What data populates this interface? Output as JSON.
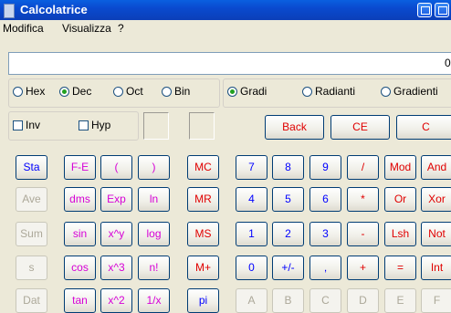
{
  "window": {
    "title": "Calcolatrice"
  },
  "menu": [
    "Modifica",
    "Visualizza",
    "?"
  ],
  "display": {
    "value": "0,"
  },
  "base_radios": [
    {
      "label": "Hex",
      "selected": false
    },
    {
      "label": "Dec",
      "selected": true
    },
    {
      "label": "Oct",
      "selected": false
    },
    {
      "label": "Bin",
      "selected": false
    }
  ],
  "angle_radios": [
    {
      "label": "Gradi",
      "selected": true
    },
    {
      "label": "Radianti",
      "selected": false
    },
    {
      "label": "Gradienti",
      "selected": false
    }
  ],
  "checkboxes": [
    {
      "label": "Inv",
      "checked": false
    },
    {
      "label": "Hyp",
      "checked": false
    }
  ],
  "edit_buttons": [
    "Back",
    "CE",
    "C"
  ],
  "sci_rows": [
    [
      "Sta",
      "F-E",
      "(",
      ")"
    ],
    [
      "Ave",
      "dms",
      "Exp",
      "ln"
    ],
    [
      "Sum",
      "sin",
      "x^y",
      "log"
    ],
    [
      "s",
      "cos",
      "x^3",
      "n!"
    ],
    [
      "Dat",
      "tan",
      "x^2",
      "1/x"
    ]
  ],
  "memory_buttons": [
    "MC",
    "MR",
    "MS",
    "M+",
    "pi"
  ],
  "num_rows": [
    [
      "7",
      "8",
      "9",
      "/",
      "Mod",
      "And"
    ],
    [
      "4",
      "5",
      "6",
      "*",
      "Or",
      "Xor"
    ],
    [
      "1",
      "2",
      "3",
      "-",
      "Lsh",
      "Not"
    ],
    [
      "0",
      "+/-",
      ",",
      "+",
      "=",
      "Int"
    ],
    [
      "A",
      "B",
      "C",
      "D",
      "E",
      "F"
    ]
  ]
}
